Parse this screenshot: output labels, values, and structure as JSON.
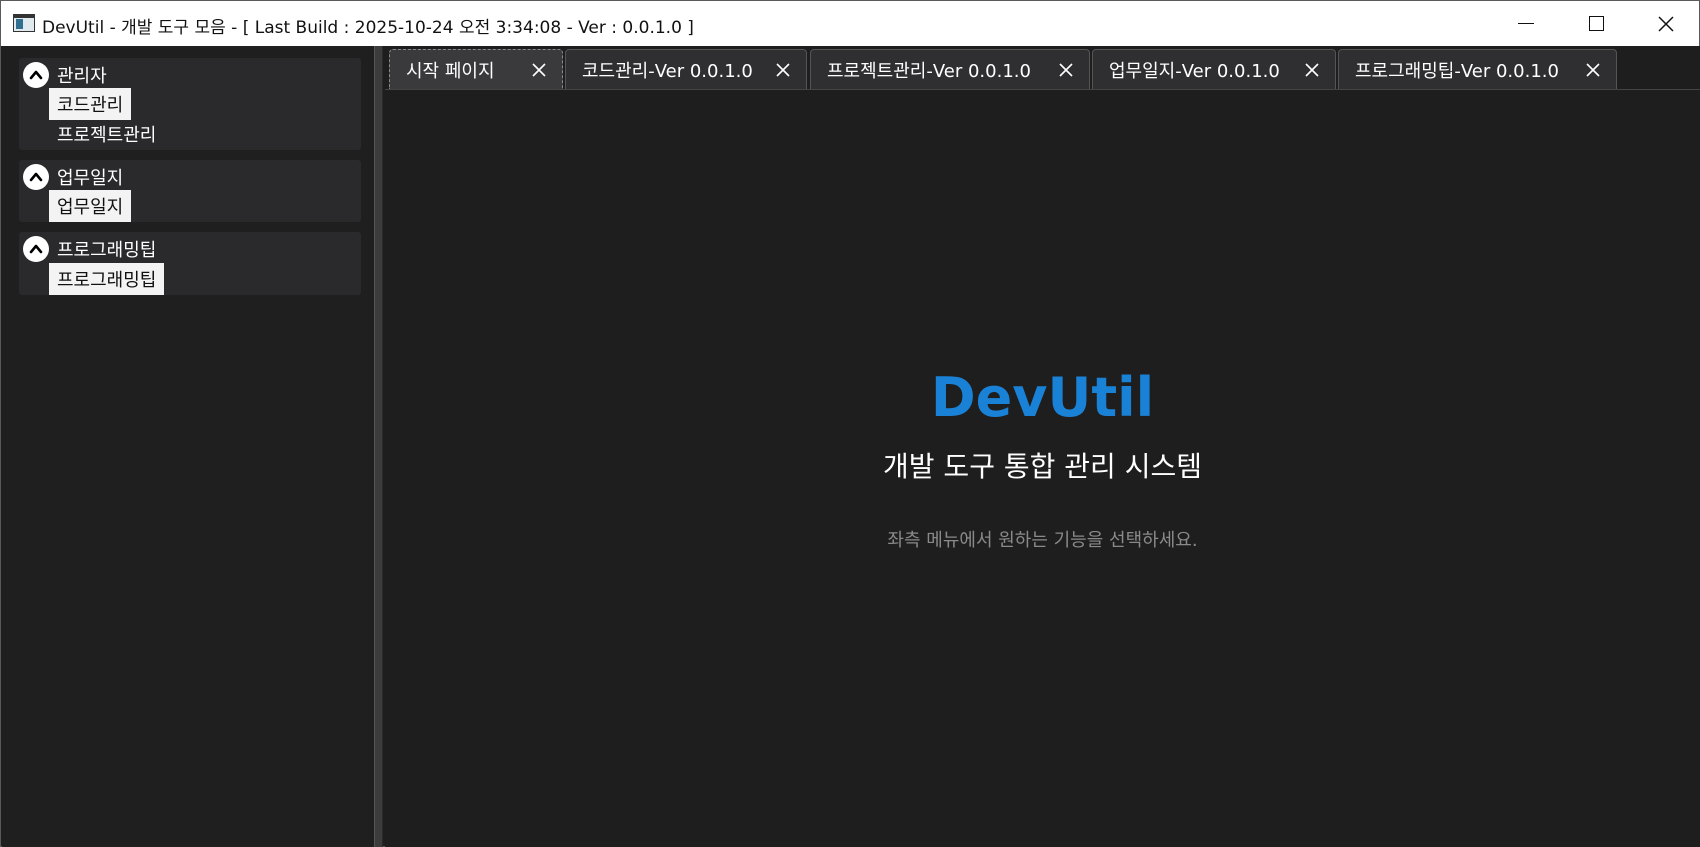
{
  "window": {
    "title": "DevUtil - 개발 도구 모음 - [ Last Build : 2025-10-24 오전 3:34:08 - Ver : 0.0.1.0 ]"
  },
  "sidebar": {
    "groups": [
      {
        "title": "관리자",
        "items": [
          {
            "label": "코드관리",
            "selected": true
          },
          {
            "label": "프로젝트관리",
            "selected": false
          }
        ]
      },
      {
        "title": "업무일지",
        "items": [
          {
            "label": "업무일지",
            "selected": true
          }
        ]
      },
      {
        "title": "프로그래밍팁",
        "items": [
          {
            "label": "프로그래밍팁",
            "selected": true
          }
        ]
      }
    ]
  },
  "tabs": [
    {
      "label": "시작 페이지",
      "active": true
    },
    {
      "label": "코드관리-Ver 0.0.1.0",
      "active": false
    },
    {
      "label": "프로젝트관리-Ver 0.0.1.0",
      "active": false
    },
    {
      "label": "업무일지-Ver 0.0.1.0",
      "active": false
    },
    {
      "label": "프로그래밍팁-Ver 0.0.1.0",
      "active": false
    }
  ],
  "start_page": {
    "title": "DevUtil",
    "subtitle": "개발 도구 통합 관리 시스템",
    "hint": "좌측 메뉴에서 원하는 기능을 선택하세요."
  },
  "colors": {
    "accent": "#1a82d6",
    "background": "#1e1e1e",
    "sidebar_group": "#2a2a2c"
  },
  "icons": {
    "app": "app-window-icon",
    "expander": "chevron-up-icon",
    "close": "close-icon"
  }
}
